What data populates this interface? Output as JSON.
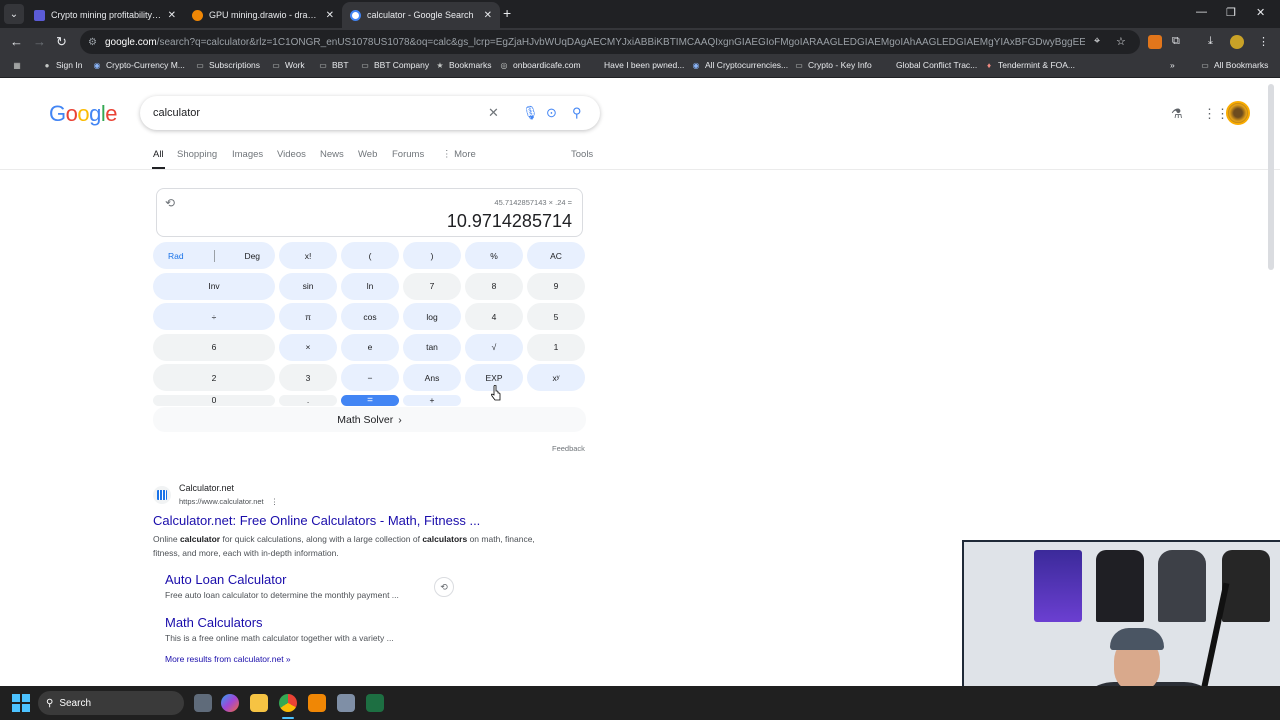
{
  "browser": {
    "tabs": [
      {
        "title": "Crypto mining profitability calc",
        "favicon_color": "#5b5bd6",
        "active": false
      },
      {
        "title": "GPU mining.drawio - draw.io",
        "favicon_color": "#f08705",
        "active": false
      },
      {
        "title": "calculator - Google Search",
        "favicon_color": "#e8eaed",
        "active": true
      }
    ],
    "new_tab_icon": "+",
    "url_host": "google.com",
    "url_path": "/search?q=calculator&rlz=1C1ONGR_enUS1078US1078&oq=calc&gs_lcrp=EgZjaHJvbWUqDAgAECMYJxiABBiKBTIMCAAQIxgnGIAEGIoFMgoIARAAGLEDGIAEMgoIAhAAGLEDGIAEMgYIAxBFGDwyBggEEEUYPDIGCAUQRRhBMgY...",
    "bookmarks": [
      {
        "label": "Sign In",
        "icon": "github-icon"
      },
      {
        "label": "Crypto-Currency M...",
        "icon": "site-icon"
      },
      {
        "label": "Subscriptions",
        "icon": "folder-icon"
      },
      {
        "label": "Work",
        "icon": "folder-icon"
      },
      {
        "label": "BBT",
        "icon": "folder-icon"
      },
      {
        "label": "BBT Company",
        "icon": "folder-icon"
      },
      {
        "label": "Bookmarks",
        "icon": "star-icon"
      },
      {
        "label": "onboardicafe.com",
        "icon": "site-icon"
      },
      {
        "label": "Have I been pwned...",
        "icon": "site-icon"
      },
      {
        "label": "All Cryptocurrencies...",
        "icon": "site-icon"
      },
      {
        "label": "Crypto - Key Info",
        "icon": "folder-icon"
      },
      {
        "label": "Global Conflict Trac...",
        "icon": "site-icon"
      },
      {
        "label": "Tendermint & FOA...",
        "icon": "site-icon"
      }
    ],
    "all_bookmarks": "All Bookmarks"
  },
  "search": {
    "logo_letters": [
      "G",
      "o",
      "o",
      "g",
      "l",
      "e"
    ],
    "logo_colors": [
      "#4285f4",
      "#ea4335",
      "#fbbc05",
      "#4285f4",
      "#34a853",
      "#ea4335"
    ],
    "query": "calculator",
    "tabs": [
      "All",
      "Shopping",
      "Images",
      "Videos",
      "News",
      "Web",
      "Forums",
      "More"
    ],
    "tools": "Tools"
  },
  "calculator": {
    "expression": "45.7142857143 × .24 =",
    "result": "10.9714285714",
    "rad": "Rad",
    "deg": "Deg",
    "keys": [
      [
        "x!",
        "(",
        ")",
        "%",
        "AC"
      ],
      [
        "Inv",
        "sin",
        "ln",
        "7",
        "8",
        "9",
        "÷"
      ],
      [
        "π",
        "cos",
        "log",
        "4",
        "5",
        "6",
        "×"
      ],
      [
        "e",
        "tan",
        "√",
        "1",
        "2",
        "3",
        "−"
      ],
      [
        "Ans",
        "EXP",
        "xʸ",
        "0",
        ".",
        "=",
        "+"
      ]
    ],
    "math_solver": "Math Solver",
    "feedback": "Feedback"
  },
  "result": {
    "site_name": "Calculator.net",
    "site_url": "https://www.calculator.net",
    "title": "Calculator.net: Free Online Calculators - Math, Fitness ...",
    "snippet_parts": [
      "Online ",
      "calculator",
      " for quick calculations, along with a large collection of ",
      "calculators",
      " on math, finance, fitness, and more, each with in-depth information."
    ],
    "sublinks": [
      {
        "title": "Auto Loan Calculator",
        "desc": "Free auto loan calculator to determine the monthly payment ..."
      },
      {
        "title": "Math Calculators",
        "desc": "This is a free online math calculator together with a variety ..."
      }
    ],
    "more_results": "More results from calculator.net »"
  },
  "taskbar": {
    "search_label": "Search"
  }
}
